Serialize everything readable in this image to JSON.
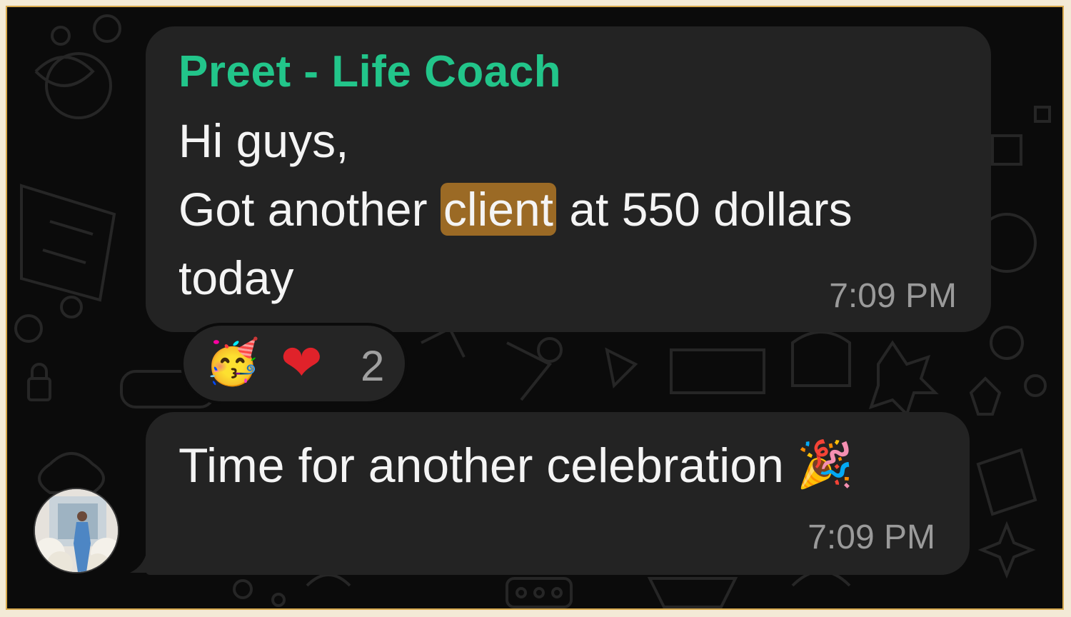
{
  "chat": {
    "message1": {
      "sender": "Preet - Life Coach",
      "line1": "Hi guys,",
      "line2_before": "Got another ",
      "line2_highlight": "client",
      "line2_after": " at 550 dollars",
      "line3": "today",
      "time": "7:09 PM",
      "reactions": {
        "emoji1": "🥳",
        "emoji2": "❤",
        "count": "2"
      }
    },
    "message2": {
      "text": "Time for another celebration",
      "emoji": "🎉",
      "time": "7:09 PM"
    }
  },
  "colors": {
    "background": "#0b0b0b",
    "bubble": "#232323",
    "sender": "#22c58a",
    "highlight": "#9b6a25",
    "timestamp": "#9a9a9a",
    "border": "#d7a94d"
  },
  "icons": {
    "avatar": "profile-photo",
    "wallpaper": "doodle-pattern"
  }
}
